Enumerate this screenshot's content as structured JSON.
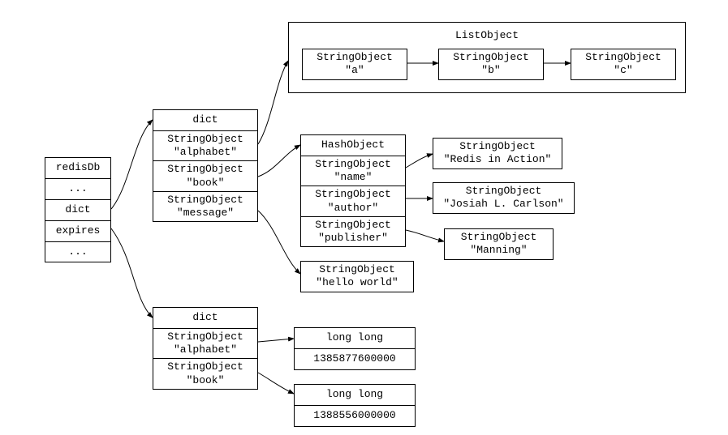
{
  "redisDb": {
    "title": "redisDb",
    "ellipsis1": "...",
    "dict": "dict",
    "expires": "expires",
    "ellipsis2": "..."
  },
  "dictTop": {
    "title": "dict",
    "key0": "StringObject\n\"alphabet\"",
    "key1": "StringObject\n\"book\"",
    "key2": "StringObject\n\"message\""
  },
  "dictBottom": {
    "title": "dict",
    "key0": "StringObject\n\"alphabet\"",
    "key1": "StringObject\n\"book\""
  },
  "listObject": {
    "title": "ListObject",
    "item0": "StringObject\n\"a\"",
    "item1": "StringObject\n\"b\"",
    "item2": "StringObject\n\"c\""
  },
  "hashObject": {
    "title": "HashObject",
    "field0": "StringObject\n\"name\"",
    "field1": "StringObject\n\"author\"",
    "field2": "StringObject\n\"publisher\""
  },
  "hashValues": {
    "val0": "StringObject\n\"Redis in Action\"",
    "val1": "StringObject\n\"Josiah L. Carlson\"",
    "val2": "StringObject\n\"Manning\""
  },
  "message": "StringObject\n\"hello world\"",
  "expireAlphabet": {
    "type": "long long",
    "value": "1385877600000"
  },
  "expireBook": {
    "type": "long long",
    "value": "1388556000000"
  }
}
